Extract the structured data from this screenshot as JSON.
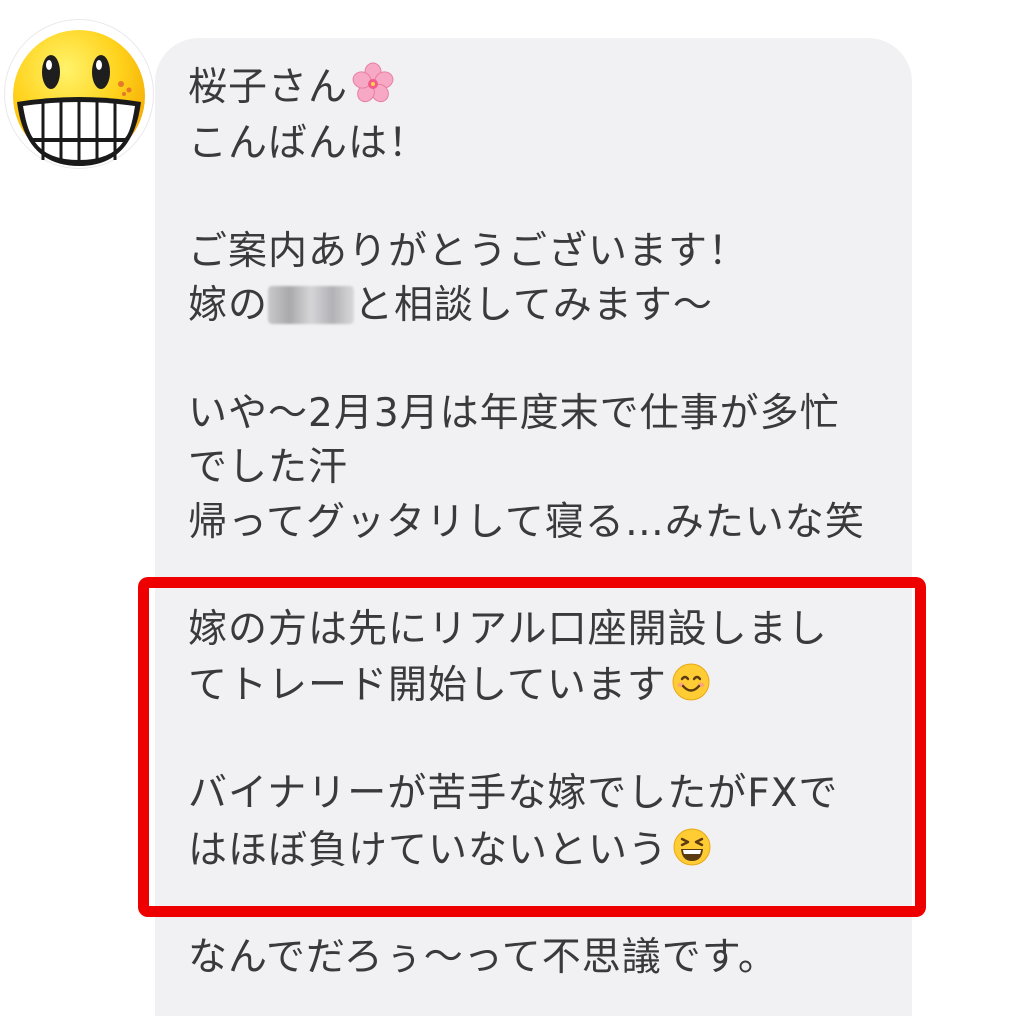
{
  "sender": {
    "avatar_icon": "grinning-face-icon"
  },
  "message": {
    "greeting_name": "桜子さん",
    "greeting_emoji": "cherry-blossom-icon",
    "line_greeting": "こんばんは！",
    "line_thanks": "ご案内ありがとうございます！",
    "line_consult_prefix": "嫁の",
    "line_consult_suffix": "と相談してみます〜",
    "line_busy_1": "いや〜2月3月は年度末で仕事が多忙",
    "line_busy_2": "でした汗",
    "line_busy_3": "帰ってグッタリして寝る…みたいな笑",
    "line_wife_1": "嫁の方は先にリアル口座開設しまし",
    "line_wife_2": "てトレード開始しています",
    "line_wife_2_emoji": "smiling-face-icon",
    "line_fx_1": "バイナリーが苦手な嫁でしたがFXで",
    "line_fx_2": "はほぼ負けていないという",
    "line_fx_2_emoji": "laughing-face-icon",
    "line_wonder": "なんでだろぅ〜って不思議です。"
  },
  "colors": {
    "bubble": "#f1f1f4",
    "text": "#3a3a3c",
    "highlight": "#ef0000"
  }
}
